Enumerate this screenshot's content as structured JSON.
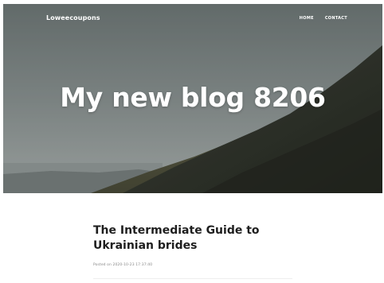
{
  "header": {
    "brand": "Loweecoupons",
    "nav": [
      {
        "label": "HOME"
      },
      {
        "label": "CONTACT"
      }
    ]
  },
  "hero": {
    "title": "My new blog 8206"
  },
  "post": {
    "title": "The Intermediate Guide to Ukrainian brides",
    "meta": "Posted on 2020-10-23 17:37:40"
  }
}
